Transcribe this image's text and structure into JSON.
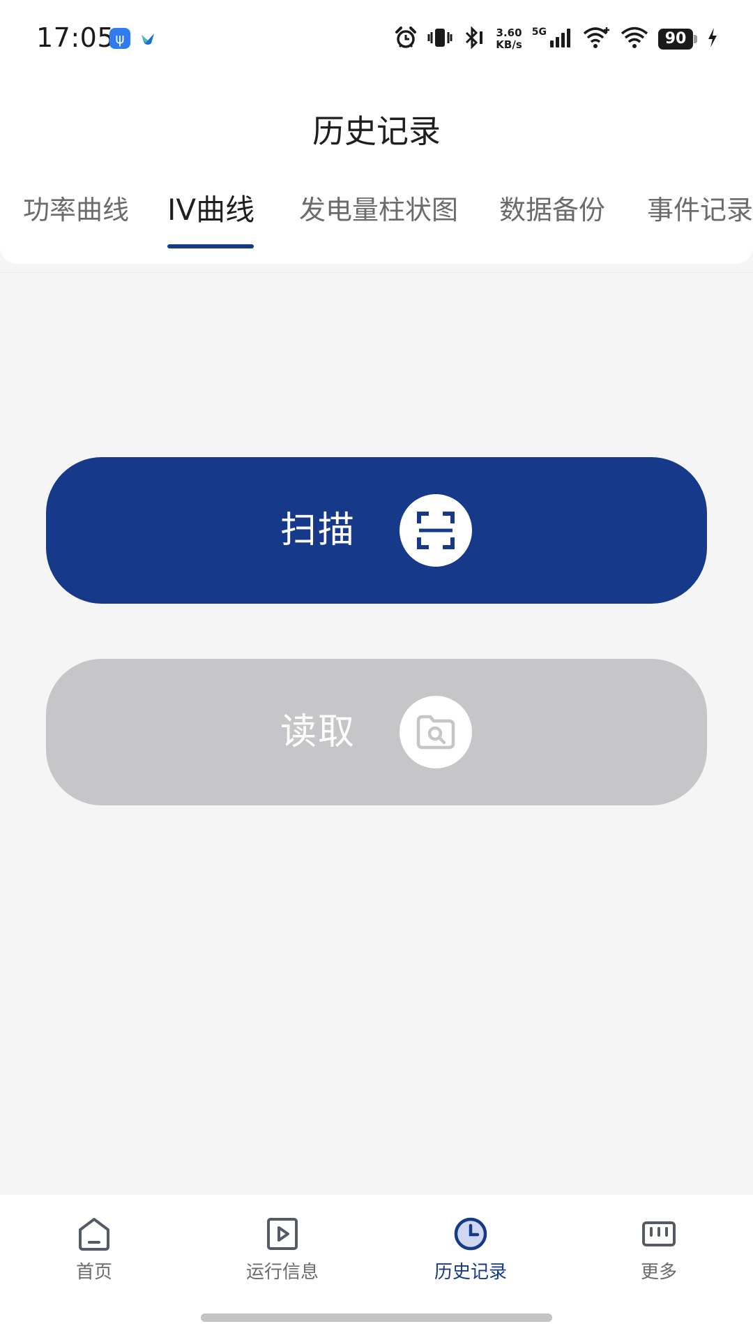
{
  "status_bar": {
    "time": "17:05",
    "net_speed_value": "3.60",
    "net_speed_unit": "KB/s",
    "network_type": "5G",
    "battery": "90",
    "icons": [
      "usb-icon",
      "app-notification-icon",
      "alarm-icon",
      "vibrate-icon",
      "bluetooth-icon",
      "signal-icon",
      "wifi-plus-icon",
      "wifi-icon",
      "charging-icon"
    ]
  },
  "header": {
    "title": "历史记录"
  },
  "tabs": [
    {
      "label": "功率曲线",
      "active": false
    },
    {
      "label": "IV曲线",
      "active": true
    },
    {
      "label": "发电量柱状图",
      "active": false
    },
    {
      "label": "数据备份",
      "active": false
    },
    {
      "label": "事件记录",
      "active": false
    }
  ],
  "actions": {
    "scan": {
      "label": "扫描",
      "icon": "scan-icon",
      "color": "#163a89",
      "enabled": true
    },
    "read": {
      "label": "读取",
      "icon": "folder-search-icon",
      "color": "#c6c5c8",
      "enabled": false
    }
  },
  "bottom_nav": [
    {
      "label": "首页",
      "icon": "home-icon",
      "active": false
    },
    {
      "label": "运行信息",
      "icon": "play-monitor-icon",
      "active": false
    },
    {
      "label": "历史记录",
      "icon": "clock-icon",
      "active": true
    },
    {
      "label": "更多",
      "icon": "more-icon",
      "active": false
    }
  ],
  "colors": {
    "accent": "#173a87",
    "background": "#f5f5f6",
    "disabled": "#c6c5c8"
  }
}
